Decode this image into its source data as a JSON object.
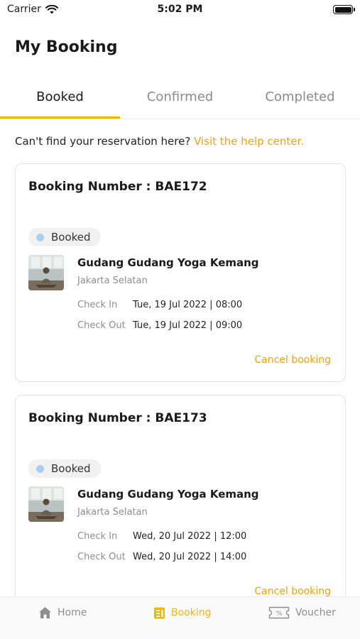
{
  "status_bar": {
    "carrier": "Carrier",
    "time": "5:02 PM"
  },
  "header": {
    "title": "My Booking"
  },
  "tabs": [
    {
      "label": "Booked",
      "active": true
    },
    {
      "label": "Confirmed",
      "active": false
    },
    {
      "label": "Completed",
      "active": false
    }
  ],
  "help": {
    "text": "Can't find your reservation here?",
    "link": "Visit the help center."
  },
  "bookings": [
    {
      "title": "Booking Number : BAE172",
      "status": "Booked",
      "venue": "Gudang Gudang Yoga Kemang",
      "city": "Jakarta Selatan",
      "check_in_label": "Check In",
      "check_in": "Tue, 19 Jul 2022 | 08:00",
      "check_out_label": "Check Out",
      "check_out": "Tue, 19 Jul 2022 | 09:00",
      "cancel": "Cancel booking"
    },
    {
      "title": "Booking Number : BAE173",
      "status": "Booked",
      "venue": "Gudang Gudang Yoga Kemang",
      "city": "Jakarta Selatan",
      "check_in_label": "Check In",
      "check_in": "Wed, 20 Jul 2022 | 12:00",
      "check_out_label": "Check Out",
      "check_out": "Wed, 20 Jul 2022 | 14:00",
      "cancel": "Cancel booking"
    }
  ],
  "tabbar": [
    {
      "label": "Home",
      "icon": "home-icon",
      "active": false
    },
    {
      "label": "Booking",
      "icon": "booking-icon",
      "active": true
    },
    {
      "label": "Voucher",
      "icon": "voucher-icon",
      "active": false
    }
  ],
  "colors": {
    "accent": "#f2b705",
    "link": "#f2a20c",
    "status_dot": "#a9d0f2",
    "muted": "#8e8e8e"
  }
}
